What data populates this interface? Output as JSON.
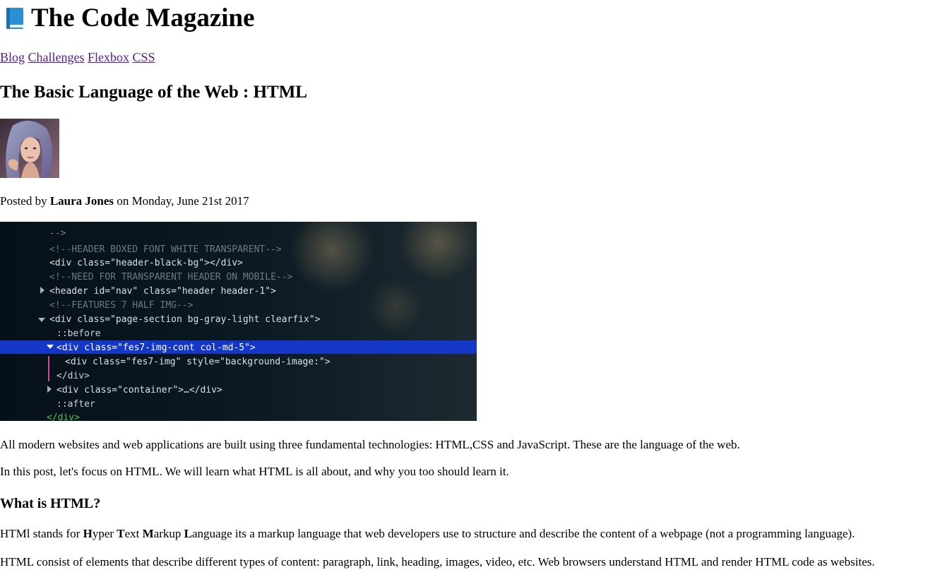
{
  "header": {
    "icon": "blue-book-icon",
    "title": "The Code Magazine"
  },
  "nav": {
    "links": [
      "Blog",
      "Challenges",
      "Flexbox",
      "CSS"
    ],
    "link_color": "#551a8b"
  },
  "post": {
    "title": "The Basic Language of the Web : HTML",
    "author_avatar": "author-portrait-photo",
    "meta": {
      "prefix": "Posted by",
      "author": "Laura Jones",
      "date_text": "on Monday, June 21st 2017"
    },
    "hero_image": {
      "kind": "code-editor-screenshot-photo",
      "code_lines": [
        "-->",
        "<!--HEADER BOXED FONT WHITE TRANSPARENT-->",
        "<div class=\"header-black-bg\"></div>",
        "<!--NEED FOR TRANSPARENT HEADER ON MOBILE-->",
        "<header id=\"nav\" class=\"header header-1\">",
        "<!--FEATURES 7 HALF IMG-->",
        "<div class=\"page-section bg-gray-light clearfix\">",
        "::before",
        "<div class=\"fes7-img-cont col-md-5\">",
        "<div class=\"fes7-img\" style=\"background-image:\">",
        "</div>",
        "<div class=\"container\">…</div>",
        "::after",
        "</div>"
      ]
    },
    "intro_paragraphs": [
      "All modern websites and web applications are built using three fundamental technologies: HTML,CSS and JavaScript. These are the language of the web.",
      "In this post, let's focus on HTML. We will learn what HTML is all about, and why you too should learn it."
    ],
    "section": {
      "heading": "What is HTML?",
      "definition": {
        "before": "HTMl stands for ",
        "h_bold": "H",
        "h_rest": "yper ",
        "t_bold": "T",
        "t_rest": "ext ",
        "m_bold": "M",
        "m_rest": "arkup ",
        "l_bold": "L",
        "l_rest": "anguage its a markup language that web developers use to structure and describe the content of a webpage (not a programming language)."
      },
      "paragraph2": "HTML consist of elements that describe different types of content: paragraph, link, heading, images, video, etc. Web browsers understand HTML and render HTML code as websites."
    }
  }
}
